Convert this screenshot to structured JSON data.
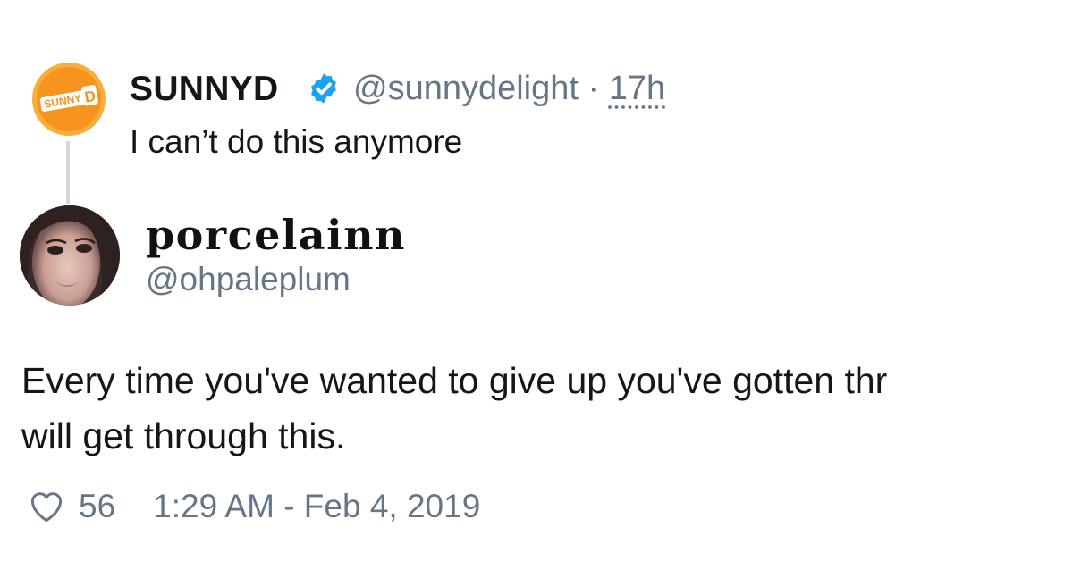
{
  "parent": {
    "avatar_text": "SUNNY D",
    "name": "SUNNYD",
    "handle_time": "@sunnydelight · 17h",
    "handle": "@sunnydelight",
    "time": "17h",
    "text": "I can’t do this anymore",
    "verified": true
  },
  "reply": {
    "name": "porcelainn",
    "handle": "@ohpaleplum",
    "body_lines": [
      "Every time you've wanted to give up you've gotten thr",
      "will get through this."
    ],
    "likes": "56",
    "timestamp": "1:29 AM - Feb 4, 2019"
  },
  "colors": {
    "secondary_text": "#657786",
    "verified": "#1da1f2",
    "sunny_orange": "#f7941d",
    "thread_line": "#cfd9de"
  },
  "icons": [
    "verified-badge-icon",
    "heart-icon"
  ]
}
